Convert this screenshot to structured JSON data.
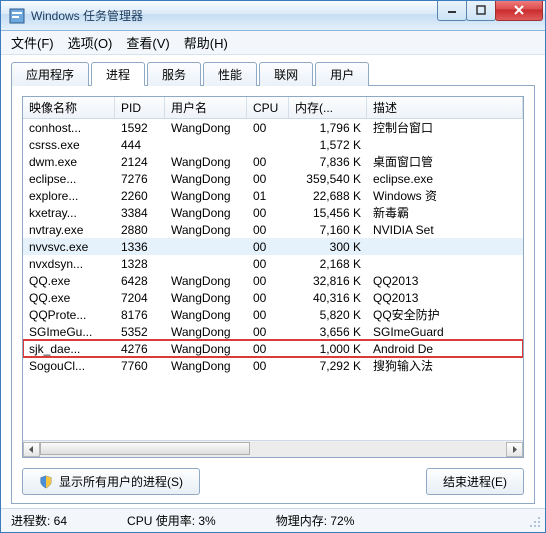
{
  "window": {
    "title": "Windows 任务管理器"
  },
  "menu": {
    "file": "文件(F)",
    "options": "选项(O)",
    "view": "查看(V)",
    "help": "帮助(H)"
  },
  "tabs": {
    "apps": "应用程序",
    "processes": "进程",
    "services": "服务",
    "performance": "性能",
    "network": "联网",
    "users": "用户"
  },
  "columns": {
    "image": "映像名称",
    "pid": "PID",
    "user": "用户名",
    "cpu": "CPU",
    "mem": "内存(...",
    "desc": "描述"
  },
  "rows": [
    {
      "image": "conhost...",
      "pid": "1592",
      "user": "WangDong",
      "cpu": "00",
      "mem": "1,796 K",
      "desc": "控制台窗口",
      "sel": false,
      "hl": false
    },
    {
      "image": "csrss.exe",
      "pid": "444",
      "user": "",
      "cpu": "",
      "mem": "1,572 K",
      "desc": "",
      "sel": false,
      "hl": false
    },
    {
      "image": "dwm.exe",
      "pid": "2124",
      "user": "WangDong",
      "cpu": "00",
      "mem": "7,836 K",
      "desc": "桌面窗口管",
      "sel": false,
      "hl": false
    },
    {
      "image": "eclipse...",
      "pid": "7276",
      "user": "WangDong",
      "cpu": "00",
      "mem": "359,540 K",
      "desc": "eclipse.exe",
      "sel": false,
      "hl": false
    },
    {
      "image": "explore...",
      "pid": "2260",
      "user": "WangDong",
      "cpu": "01",
      "mem": "22,688 K",
      "desc": "Windows 资",
      "sel": false,
      "hl": false
    },
    {
      "image": "kxetray...",
      "pid": "3384",
      "user": "WangDong",
      "cpu": "00",
      "mem": "15,456 K",
      "desc": "新毒霸",
      "sel": false,
      "hl": false
    },
    {
      "image": "nvtray.exe",
      "pid": "2880",
      "user": "WangDong",
      "cpu": "00",
      "mem": "7,160 K",
      "desc": "NVIDIA Set",
      "sel": false,
      "hl": false
    },
    {
      "image": "nvvsvc.exe",
      "pid": "1336",
      "user": "",
      "cpu": "00",
      "mem": "300 K",
      "desc": "",
      "sel": true,
      "hl": false
    },
    {
      "image": "nvxdsyn...",
      "pid": "1328",
      "user": "",
      "cpu": "00",
      "mem": "2,168 K",
      "desc": "",
      "sel": false,
      "hl": false
    },
    {
      "image": "QQ.exe",
      "pid": "6428",
      "user": "WangDong",
      "cpu": "00",
      "mem": "32,816 K",
      "desc": "QQ2013",
      "sel": false,
      "hl": false
    },
    {
      "image": "QQ.exe",
      "pid": "7204",
      "user": "WangDong",
      "cpu": "00",
      "mem": "40,316 K",
      "desc": "QQ2013",
      "sel": false,
      "hl": false
    },
    {
      "image": "QQProte...",
      "pid": "8176",
      "user": "WangDong",
      "cpu": "00",
      "mem": "5,820 K",
      "desc": "QQ安全防护",
      "sel": false,
      "hl": false
    },
    {
      "image": "SGImeGu...",
      "pid": "5352",
      "user": "WangDong",
      "cpu": "00",
      "mem": "3,656 K",
      "desc": "SGImeGuard",
      "sel": false,
      "hl": false
    },
    {
      "image": "sjk_dae...",
      "pid": "4276",
      "user": "WangDong",
      "cpu": "00",
      "mem": "1,000 K",
      "desc": "Android De",
      "sel": false,
      "hl": true
    },
    {
      "image": "SogouCl...",
      "pid": "7760",
      "user": "WangDong",
      "cpu": "00",
      "mem": "7,292 K",
      "desc": "搜狗输入法",
      "sel": false,
      "hl": false
    }
  ],
  "buttons": {
    "show_all": "显示所有用户的进程(S)",
    "end": "结束进程(E)"
  },
  "status": {
    "procs": "进程数: 64",
    "cpu": "CPU 使用率: 3%",
    "mem": "物理内存: 72%"
  }
}
